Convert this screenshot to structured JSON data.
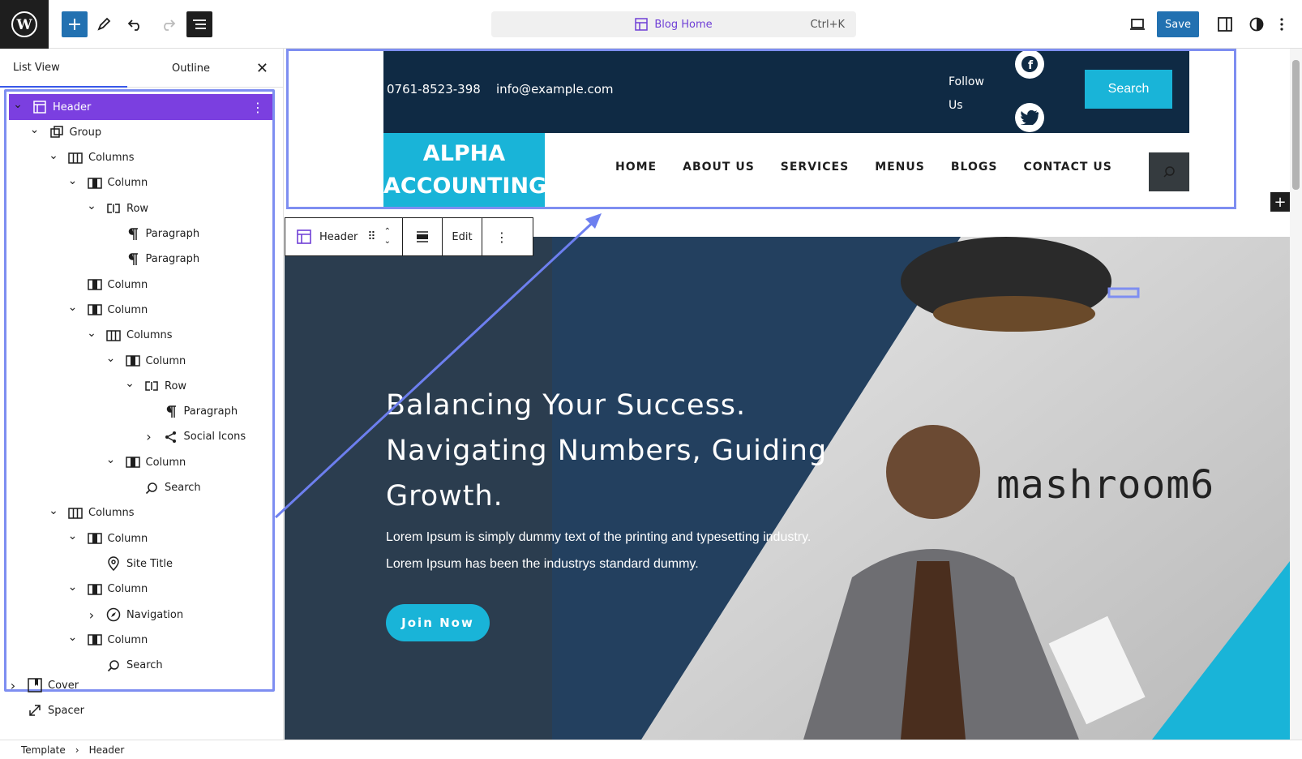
{
  "topbar": {
    "doc_title": "Blog Home",
    "shortcut": "Ctrl+K",
    "save_label": "Save"
  },
  "sidebar": {
    "tabs": [
      "List View",
      "Outline"
    ],
    "tree": [
      {
        "label": "Header",
        "depth": 0,
        "chev": "down",
        "icon": "template-part"
      },
      {
        "label": "Group",
        "depth": 1,
        "chev": "down",
        "icon": "group"
      },
      {
        "label": "Columns",
        "depth": 2,
        "chev": "down",
        "icon": "columns"
      },
      {
        "label": "Column",
        "depth": 3,
        "chev": "down",
        "icon": "column"
      },
      {
        "label": "Row",
        "depth": 4,
        "chev": "down",
        "icon": "row"
      },
      {
        "label": "Paragraph",
        "depth": 5,
        "chev": "",
        "icon": "paragraph"
      },
      {
        "label": "Paragraph",
        "depth": 5,
        "chev": "",
        "icon": "paragraph"
      },
      {
        "label": "Column",
        "depth": 3,
        "chev": "",
        "icon": "column"
      },
      {
        "label": "Column",
        "depth": 3,
        "chev": "down",
        "icon": "column"
      },
      {
        "label": "Columns",
        "depth": 4,
        "chev": "down",
        "icon": "columns"
      },
      {
        "label": "Column",
        "depth": 5,
        "chev": "down",
        "icon": "column"
      },
      {
        "label": "Row",
        "depth": 6,
        "chev": "down",
        "icon": "row"
      },
      {
        "label": "Paragraph",
        "depth": 7,
        "chev": "",
        "icon": "paragraph"
      },
      {
        "label": "Social Icons",
        "depth": 7,
        "chev": "right",
        "icon": "share"
      },
      {
        "label": "Column",
        "depth": 5,
        "chev": "down",
        "icon": "column"
      },
      {
        "label": "Search",
        "depth": 6,
        "chev": "",
        "icon": "search"
      },
      {
        "label": "Columns",
        "depth": 2,
        "chev": "down",
        "icon": "columns"
      },
      {
        "label": "Column",
        "depth": 3,
        "chev": "down",
        "icon": "column"
      },
      {
        "label": "Site Title",
        "depth": 4,
        "chev": "",
        "icon": "location"
      },
      {
        "label": "Column",
        "depth": 3,
        "chev": "down",
        "icon": "column"
      },
      {
        "label": "Navigation",
        "depth": 4,
        "chev": "right",
        "icon": "navigation"
      },
      {
        "label": "Column",
        "depth": 3,
        "chev": "down",
        "icon": "column"
      },
      {
        "label": "Search",
        "depth": 4,
        "chev": "",
        "icon": "search"
      }
    ],
    "outside": [
      {
        "label": "Cover",
        "chev": "right",
        "icon": "cover"
      },
      {
        "label": "Spacer",
        "chev": "",
        "icon": "spacer"
      }
    ]
  },
  "breadcrumbs": [
    "Template",
    "Header"
  ],
  "block_toolbar": {
    "label": "Header",
    "edit": "Edit"
  },
  "site": {
    "phone": "0761-8523-398",
    "email": "info@example.com",
    "follow": [
      "Follow",
      "Us"
    ],
    "search_button": "Search",
    "logo": [
      "ALPHA",
      "ACCOUNTING"
    ],
    "nav": [
      "HOME",
      "ABOUT US",
      "SERVICES",
      "MENUS",
      "BLOGS",
      "CONTACT US"
    ]
  },
  "hero": {
    "heading": [
      "Balancing Your Success.",
      "Navigating Numbers, Guiding",
      "Growth."
    ],
    "body": [
      "Lorem Ipsum is simply dummy text of the printing and typesetting industry.",
      "Lorem Ipsum has been the industrys standard dummy."
    ],
    "cta": "Join Now",
    "sign": "mashroom6"
  },
  "colors": {
    "accent": "#7b3fe0",
    "selection": "#7e8ef1",
    "wp_blue": "#2271b1",
    "navy": "#0f2a44",
    "cyan": "#19b4d8"
  }
}
